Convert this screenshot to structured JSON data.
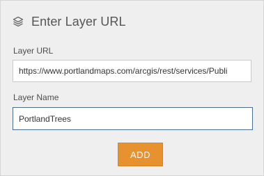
{
  "header": {
    "icon": "layers-icon",
    "title": "Enter Layer URL"
  },
  "form": {
    "url_label": "Layer URL",
    "url_value": "https://www.portlandmaps.com/arcgis/rest/services/Publi",
    "name_label": "Layer Name",
    "name_value": "PortlandTrees",
    "add_label": "ADD"
  },
  "colors": {
    "panel_background": "#efefef",
    "accent": "#e8912f",
    "focus_border": "#4a6c90"
  }
}
